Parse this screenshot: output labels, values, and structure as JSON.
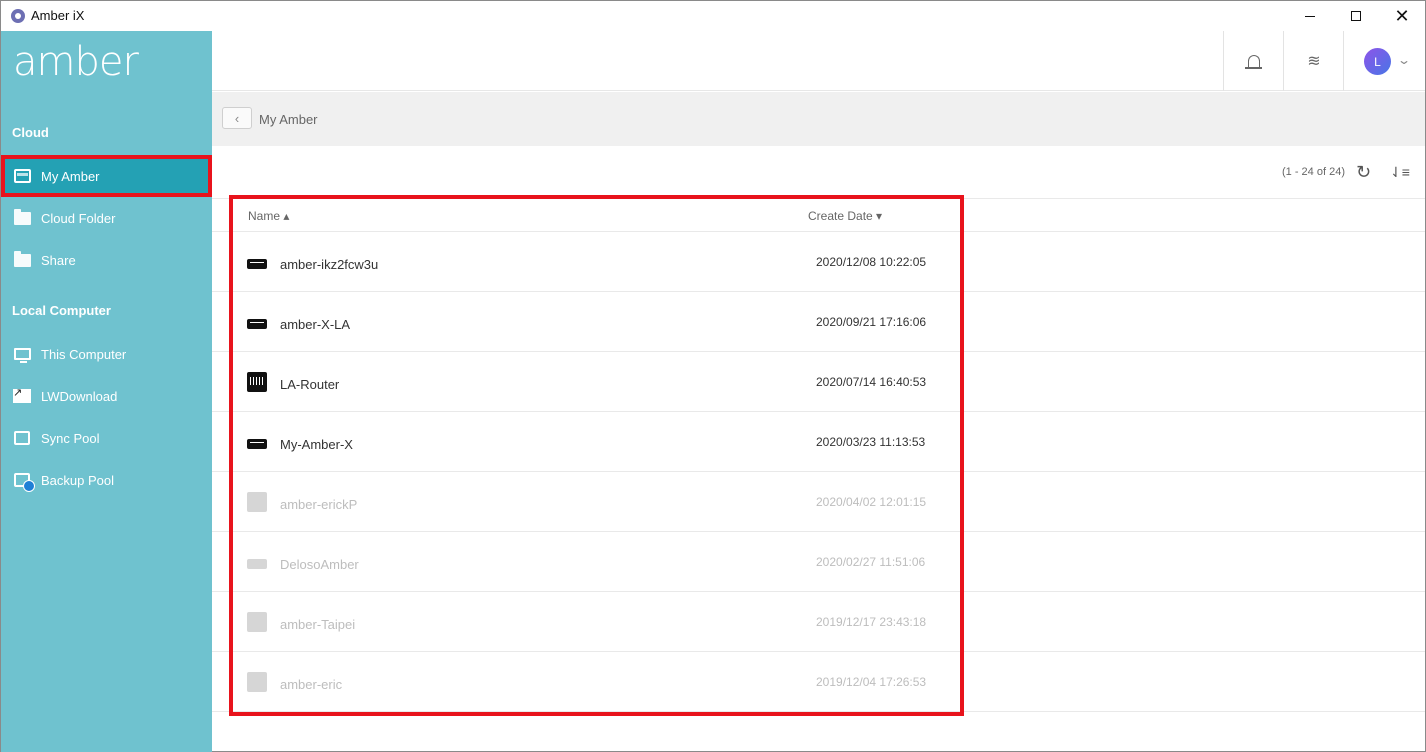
{
  "window": {
    "title": "Amber iX"
  },
  "sidebar": {
    "logo": "amber",
    "cloud_title": "Cloud",
    "cloud_items": [
      {
        "label": "My Amber",
        "icon": "nas-icon"
      },
      {
        "label": "Cloud Folder",
        "icon": "cloud-folder-icon"
      },
      {
        "label": "Share",
        "icon": "share-icon"
      }
    ],
    "local_title": "Local Computer",
    "local_items": [
      {
        "label": "This Computer",
        "icon": "monitor-icon"
      },
      {
        "label": "LWDownload",
        "icon": "download-shortcut-icon"
      },
      {
        "label": "Sync Pool",
        "icon": "sync-pool-icon"
      },
      {
        "label": "Backup Pool",
        "icon": "backup-pool-icon"
      }
    ]
  },
  "header": {
    "avatar_letter": "L"
  },
  "breadcrumb": {
    "current": "My Amber"
  },
  "toolbar": {
    "count": "(1 - 24 of 24)"
  },
  "list": {
    "col_name": "Name",
    "col_date": "Create Date",
    "rows": [
      {
        "name": "amber-ikz2fcw3u",
        "date": "2020/12/08 10:22:05",
        "status": "online",
        "device": "amber-x"
      },
      {
        "name": "amber-X-LA",
        "date": "2020/09/21 17:16:06",
        "status": "online",
        "device": "amber-x"
      },
      {
        "name": "LA-Router",
        "date": "2020/07/14 16:40:53",
        "status": "online",
        "device": "router"
      },
      {
        "name": "My-Amber-X",
        "date": "2020/03/23 11:13:53",
        "status": "online",
        "device": "amber-x"
      },
      {
        "name": "amber-erickP",
        "date": "2020/04/02 12:01:15",
        "status": "offline",
        "device": "amber"
      },
      {
        "name": "DelosoAmber",
        "date": "2020/02/27 11:51:06",
        "status": "offline",
        "device": "amber-x"
      },
      {
        "name": "amber-Taipei",
        "date": "2019/12/17 23:43:18",
        "status": "offline",
        "device": "amber"
      },
      {
        "name": "amber-eric",
        "date": "2019/12/04 17:26:53",
        "status": "offline",
        "device": "amber"
      }
    ]
  }
}
